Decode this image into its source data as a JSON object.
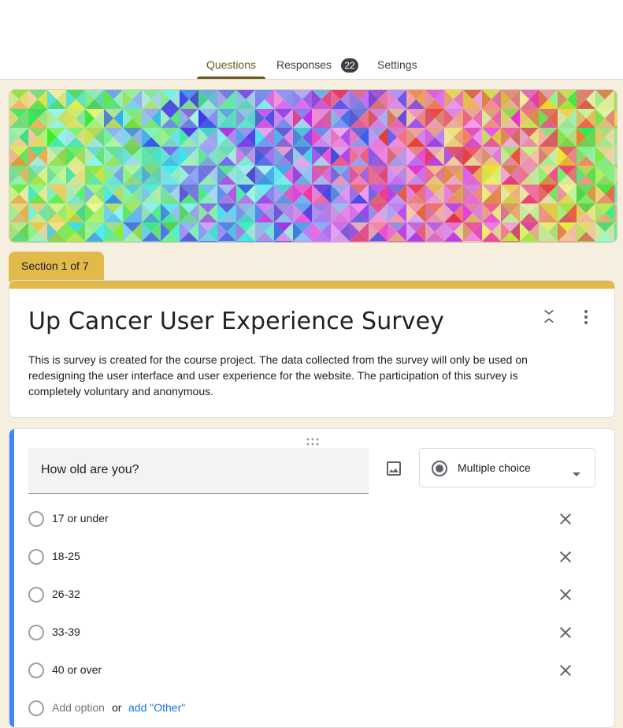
{
  "tabs": {
    "questions": "Questions",
    "responses": "Responses",
    "responses_count": "22",
    "settings": "Settings"
  },
  "section": {
    "label": "Section 1 of 7"
  },
  "form": {
    "title": "Up Cancer User Experience Survey",
    "description": "This is survey is created for the course project. The data collected from the survey will only be used on redesigning the user interface and user experience for the website. The participation of this survey is completely voluntary and anonymous."
  },
  "question": {
    "title": "How old are you?",
    "type": "Multiple choice",
    "options": [
      "17 or under",
      "18-25",
      "26-32",
      "33-39",
      "40 or over"
    ],
    "add_option_placeholder": "Add option",
    "or_text": "or",
    "add_other_label": "add \"Other\""
  },
  "icons": [
    "collapse-icon",
    "more-vert-icon",
    "drag-handle-icon",
    "image-icon",
    "radio-checked-icon",
    "dropdown-arrow-icon",
    "close-icon"
  ],
  "colors": {
    "theme": "#e2b94b",
    "accent": "#4285f4",
    "background": "#f6efe0",
    "active_tab": "#6b5a1d",
    "link": "#1a73e8"
  }
}
